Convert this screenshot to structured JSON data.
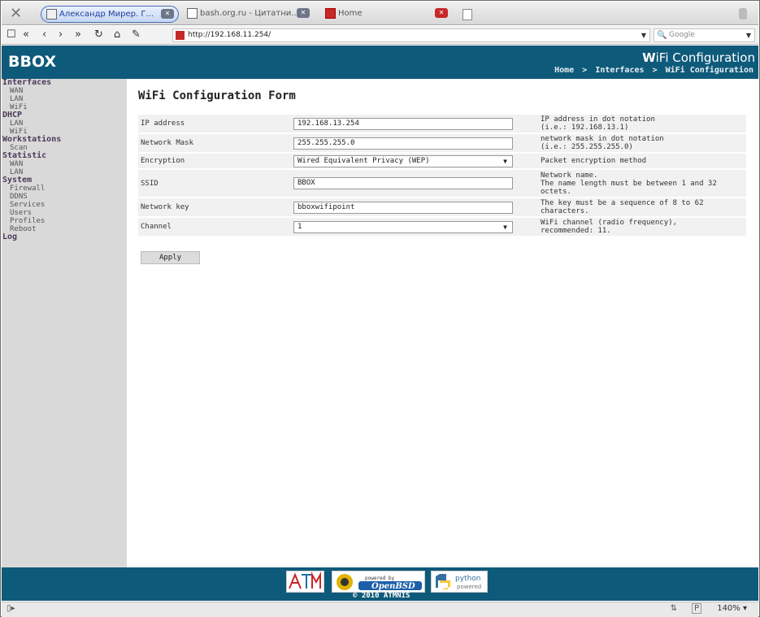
{
  "browser": {
    "tabs": [
      {
        "label": "Александр Мирер. Г..."
      },
      {
        "label": "bash.org.ru - Цитатни..."
      },
      {
        "label": "Home"
      }
    ],
    "url": "http://192.168.11.254/",
    "search_placeholder": "Google",
    "zoom": "140%"
  },
  "header": {
    "brand": "BBOX",
    "title_first": "W",
    "title_rest": "iFi Configuration",
    "breadcrumb": [
      "Home",
      ">",
      "Interfaces",
      ">",
      "WiFi Configuration"
    ]
  },
  "sidebar": [
    {
      "section": "Interfaces",
      "items": [
        "WAN",
        "LAN",
        "WiFi"
      ]
    },
    {
      "section": "DHCP",
      "items": [
        "LAN",
        "WiFi"
      ]
    },
    {
      "section": "Workstations",
      "items": [
        "Scan"
      ]
    },
    {
      "section": "Statistic",
      "items": [
        "WAN",
        "LAN"
      ]
    },
    {
      "section": "System",
      "items": [
        "Firewall",
        "DDNS",
        "Services",
        "Users",
        "Profiles",
        "Reboot"
      ]
    },
    {
      "section": "Log",
      "items": []
    }
  ],
  "form": {
    "title": "WiFi Configuration Form",
    "rows": [
      {
        "label": "IP address",
        "type": "text",
        "value": "192.168.13.254",
        "hint": "IP address in dot notation\n(i.e.: 192.168.13.1)"
      },
      {
        "label": "Network Mask",
        "type": "text",
        "value": "255.255.255.0",
        "hint": "network mask in dot notation\n(i.e.: 255.255.255.0)"
      },
      {
        "label": "Encryption",
        "type": "select",
        "value": "Wired Equivalent Privacy (WEP)",
        "hint": "Packet encryption method"
      },
      {
        "label": "SSID",
        "type": "text",
        "value": "BBOX",
        "hint": "Network name.\nThe name length must be between 1 and 32\noctets."
      },
      {
        "label": "Network key",
        "type": "text",
        "value": "bboxwifipoint",
        "hint": "The key must be a sequence of 8 to 62\ncharacters."
      },
      {
        "label": "Channel",
        "type": "select",
        "value": "1",
        "hint": "WiFi channel (radio frequency),\nrecommended: 11."
      }
    ],
    "apply_label": "Apply"
  },
  "footer": {
    "atm_logo": "ATM",
    "openbsd_top": "powered by",
    "openbsd_name": "OpenBSD",
    "python_top": "python",
    "python_bottom": "powered",
    "copyright": "© 2010 ATMNIS"
  }
}
